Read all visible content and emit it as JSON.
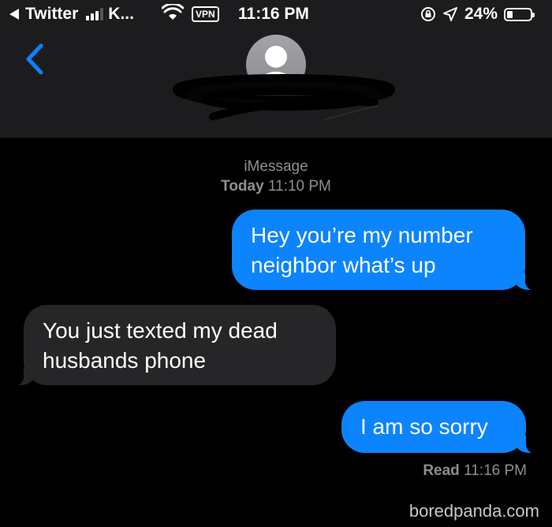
{
  "status_bar": {
    "back_app": "Twitter",
    "carrier": "K...",
    "vpn": "VPN",
    "time": "11:16 PM",
    "battery": "24%",
    "battery_level": 0.24
  },
  "header": {
    "back_icon": "chevron-left-icon",
    "avatar_icon": "person-avatar-icon"
  },
  "conversation": {
    "service": "iMessage",
    "date_label": "Today",
    "date_time": "11:10 PM",
    "messages": [
      {
        "direction": "sent",
        "text": "Hey you’re my number neighbor what’s up"
      },
      {
        "direction": "received",
        "text": "You just texted my dead husbands phone"
      },
      {
        "direction": "sent",
        "text": "I am so sorry"
      }
    ],
    "read_label": "Read",
    "read_time": "11:16 PM"
  },
  "watermark": "boredpanda.com",
  "colors": {
    "sent_bubble": "#0b84fe",
    "received_bubble": "#262629",
    "accent": "#0a84ff",
    "header_bg": "#1c1c1e"
  }
}
